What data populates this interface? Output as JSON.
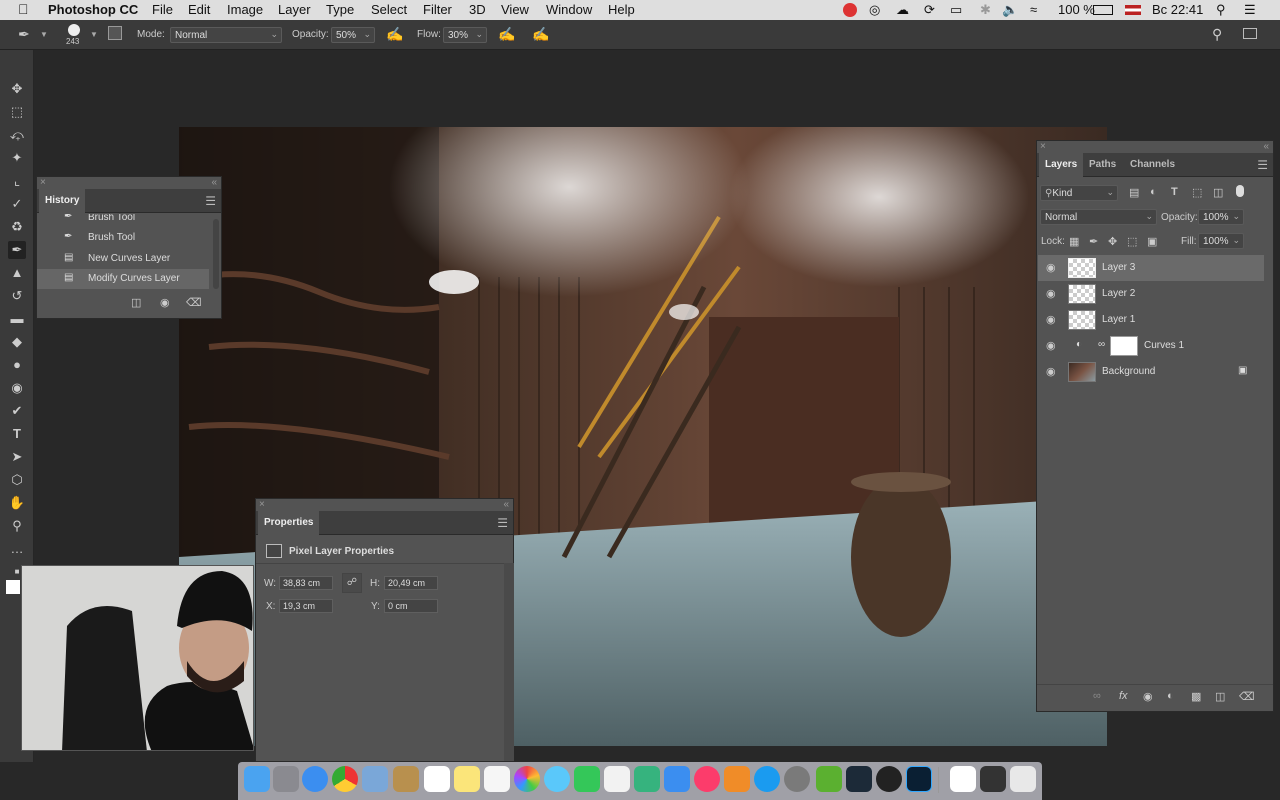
{
  "menubar": {
    "app_name": "Photoshop CC",
    "items": [
      "File",
      "Edit",
      "Image",
      "Layer",
      "Type",
      "Select",
      "Filter",
      "3D",
      "View",
      "Window",
      "Help"
    ],
    "battery": "100 %",
    "clock": "Вс 22:41"
  },
  "options": {
    "brush_size": "243",
    "mode_label": "Mode:",
    "mode_value": "Normal",
    "opacity_label": "Opacity:",
    "opacity_value": "50%",
    "flow_label": "Flow:",
    "flow_value": "30%"
  },
  "history": {
    "title": "History",
    "items": [
      {
        "label": "Brush Tool",
        "icon": "brush-icon"
      },
      {
        "label": "Brush Tool",
        "icon": "brush-icon"
      },
      {
        "label": "New Curves Layer",
        "icon": "document-icon"
      },
      {
        "label": "Modify Curves Layer",
        "icon": "document-icon"
      }
    ]
  },
  "properties": {
    "title": "Properties",
    "subtitle": "Pixel Layer Properties",
    "w_label": "W:",
    "w_value": "38,83 cm",
    "h_label": "H:",
    "h_value": "20,49 cm",
    "x_label": "X:",
    "x_value": "19,3 cm",
    "y_label": "Y:",
    "y_value": "0 cm"
  },
  "layers": {
    "tabs": [
      "Layers",
      "Paths",
      "Channels"
    ],
    "kind_label": "Kind",
    "blend_mode": "Normal",
    "opacity_label": "Opacity:",
    "opacity_value": "100%",
    "lock_label": "Lock:",
    "fill_label": "Fill:",
    "fill_value": "100%",
    "items": [
      {
        "name": "Layer 3",
        "selected": true
      },
      {
        "name": "Layer 2",
        "selected": false
      },
      {
        "name": "Layer 1",
        "selected": false
      },
      {
        "name": "Curves 1",
        "selected": false
      },
      {
        "name": "Background",
        "selected": false
      }
    ]
  },
  "colors": {
    "app_bg": "#282828",
    "panel": "#535353",
    "selected_layer": "#6a6a6a"
  }
}
